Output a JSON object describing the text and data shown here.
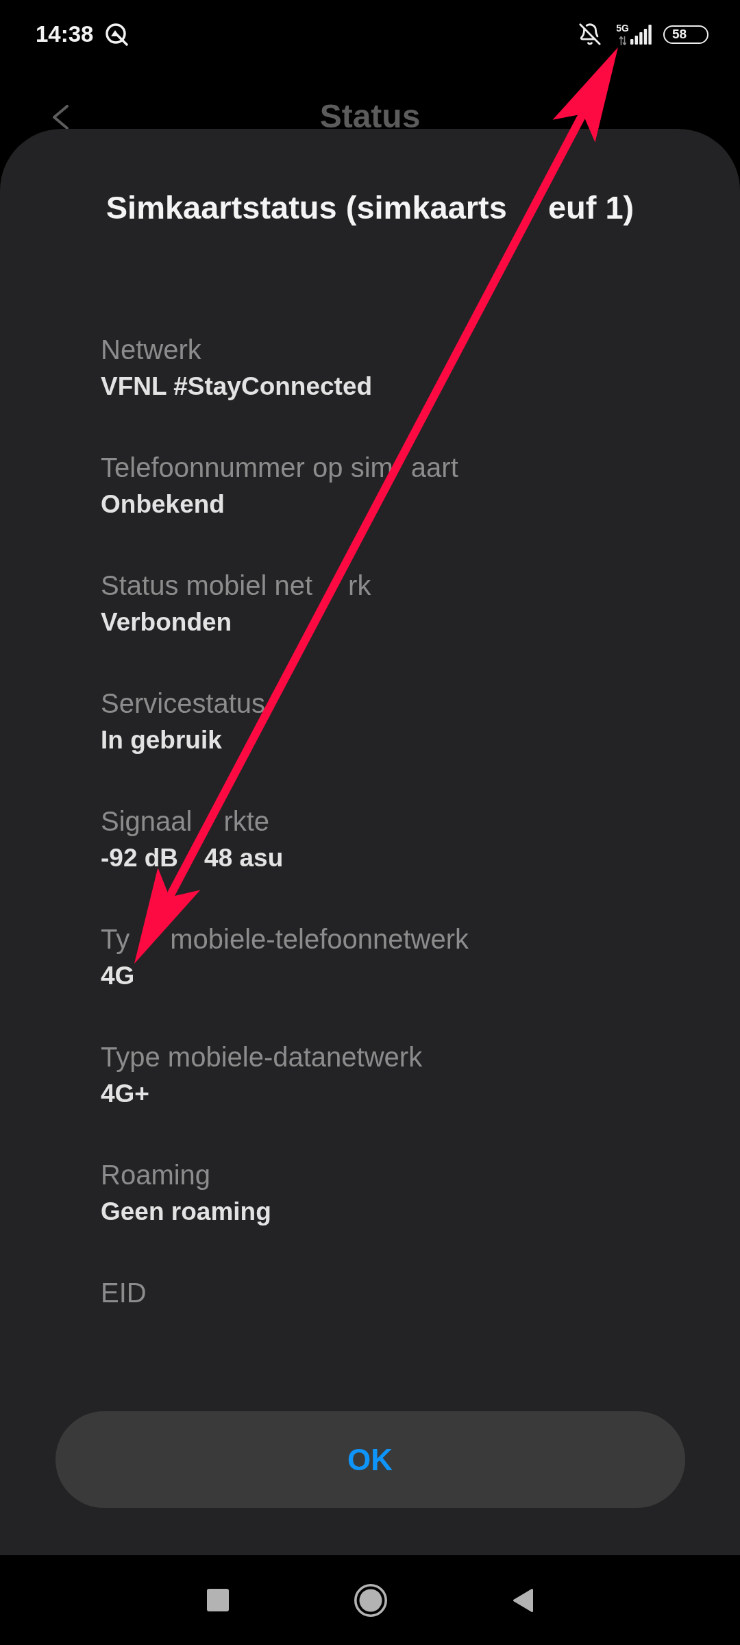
{
  "status_bar": {
    "time": "14:38",
    "network_type": "5G",
    "battery": "58"
  },
  "header": {
    "title": "Status"
  },
  "dialog": {
    "title": [
      "Simkaartstatus (simkaarts",
      "euf 1)"
    ],
    "fields": [
      {
        "label": "Netwerk",
        "value": "VFNL #StayConnected"
      },
      {
        "label": [
          "Telefoonnummer op sim",
          "aart"
        ],
        "value": "Onbekend"
      },
      {
        "label": [
          "Status mobiel net",
          "rk"
        ],
        "value": "Verbonden"
      },
      {
        "label": "Servicestatus",
        "value": "In gebruik"
      },
      {
        "label": [
          "Signaal",
          "rkte"
        ],
        "value": [
          "-92 dB",
          "48 asu"
        ]
      },
      {
        "label": [
          "Ty",
          "mobiele-telefoonnetwerk"
        ],
        "value": "4G"
      },
      {
        "label": "Type mobiele-datanetwerk",
        "value": "4G+"
      },
      {
        "label": "Roaming",
        "value": "Geen roaming"
      },
      {
        "label": "EID"
      }
    ],
    "button": "OK"
  }
}
